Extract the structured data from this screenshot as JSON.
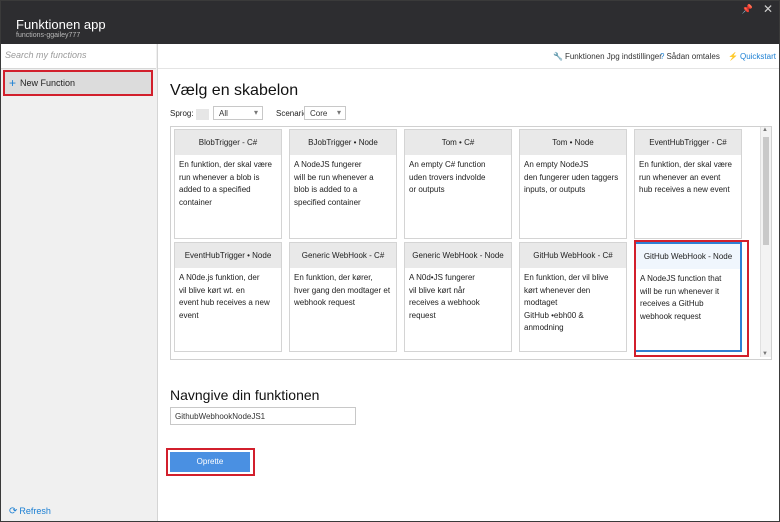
{
  "titlebar": {
    "title": "Funktionen app",
    "subtitle": "functions-ggailey777"
  },
  "sidebar": {
    "search_placeholder": "Search my functions",
    "new_function": "New Function",
    "refresh": "Refresh"
  },
  "topbar": {
    "settings": "Funktionen Jpg indstillinger",
    "howto": "Sådan omtales",
    "quickstart": "Quickstart"
  },
  "main": {
    "heading": "Vælg en skabelon",
    "language_label": "Sprog:",
    "language_value": "All",
    "scenario_label": "Scenarie:",
    "scenario_value": "Core",
    "templates": [
      {
        "title": "BlobTrigger - C#",
        "desc": [
          "En funktion, der skal være",
          "run whenever a blob is",
          "added to a specified",
          "container"
        ]
      },
      {
        "title": "BJobTrigger • Node",
        "desc": [
          "A NodeJS fungerer",
          "will be run whenever a",
          "blob is added to a",
          "specified container"
        ]
      },
      {
        "title": "Tom •       C#",
        "desc": [
          "An empty C# function",
          "uden trovers indvolde",
          "or outputs"
        ]
      },
      {
        "title": "Tom • Node",
        "desc": [
          "An empty NodeJS",
          "den fungerer  uden taggers",
          "inputs, or outputs"
        ]
      },
      {
        "title": "EventHubTrigger - C#",
        "desc": [
          "En funktion, der skal være",
          "run whenever an event",
          "hub receives a new event"
        ]
      },
      {
        "title": "EventHubTrigger • Node",
        "desc": [
          "A N0de.js funktion, der",
          "vil blive kørt wt. en",
          "event hub receives a new",
          "event"
        ]
      },
      {
        "title": "Generic WebHook - C#",
        "desc": [
          "En funktion, der kører,",
          "hver gang den modtager et",
          "webhook request"
        ]
      },
      {
        "title": "Generic WebHook - Node",
        "desc": [
          "A N0d•JS fungerer",
          "vil blive kørt når",
          "receives a webhook",
          "request"
        ]
      },
      {
        "title": "GitHub WebHook - C#",
        "desc": [
          "En funktion, der vil blive",
          "kørt whenever  den modtaget",
          "GitHub •ebh00 & anmodning"
        ]
      },
      {
        "title": "GitHub WebHook - Node",
        "desc": [
          "A NodeJS function that",
          "will be run whenever it",
          "receives a GitHub",
          "webhook request"
        ]
      }
    ],
    "name_heading": "Navngive din funktionen",
    "name_value": "GithubWebhookNodeJS1",
    "create_button": "Oprette"
  }
}
